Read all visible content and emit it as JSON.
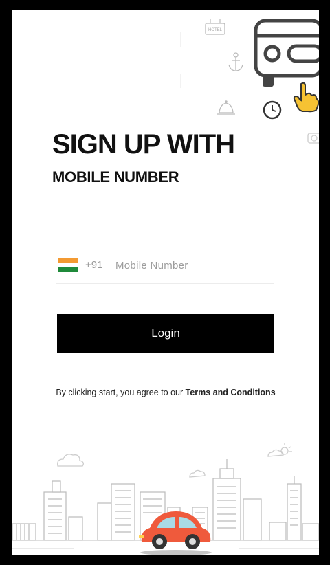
{
  "header": {
    "title": "SIGN UP WITH",
    "subtitle": "MOBILE NUMBER"
  },
  "phone": {
    "country_code": "+91",
    "placeholder": "Mobile Number",
    "flag_colors": [
      "#f39a32",
      "#ffffff",
      "#1f8a3a"
    ],
    "flag_icon": "india-flag-icon"
  },
  "login_button": {
    "label": "Login"
  },
  "terms": {
    "prefix": "By clicking start, you agree to our ",
    "link": "Terms and Conditions"
  },
  "decor": {
    "hotel_sign": "HOTEL",
    "icons": [
      "hotel-sign-icon",
      "anchor-icon",
      "bell-icon",
      "clock-icon",
      "car-outline-icon",
      "hand-pointer-icon",
      "camera-icon",
      "cloud-icon",
      "sun-icon",
      "city-skyline-icon",
      "red-car-icon"
    ]
  },
  "colors": {
    "accent": "#000000",
    "car": "#ef5a3c",
    "car_window": "#a9dbe6",
    "hand": "#f6c233"
  }
}
